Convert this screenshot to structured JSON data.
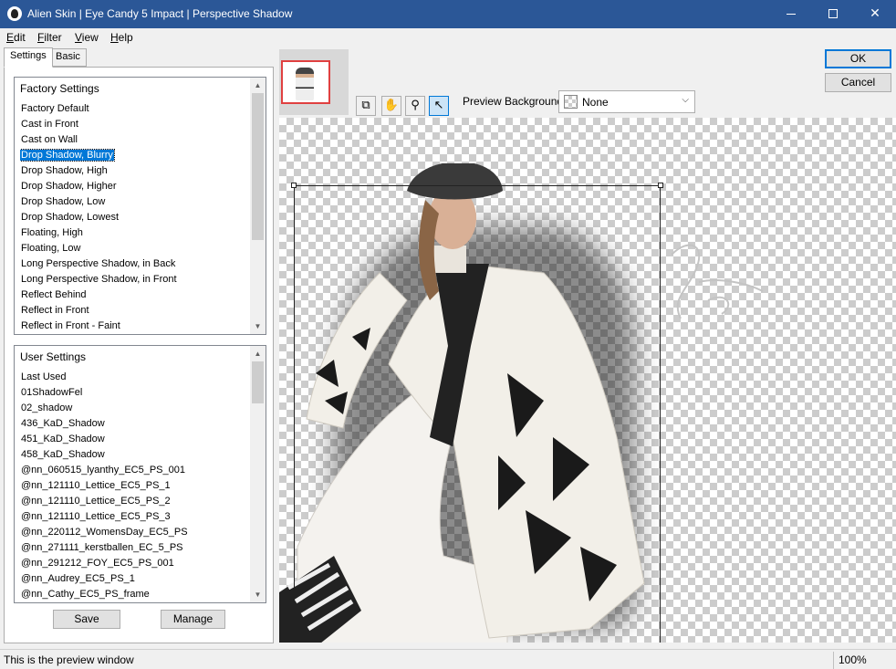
{
  "window": {
    "title": "Alien Skin | Eye Candy 5 Impact | Perspective Shadow",
    "minimize_icon": "minimize-icon",
    "maximize_icon": "maximize-icon",
    "close_icon": "close-icon"
  },
  "menu": {
    "items": [
      {
        "accel": "E",
        "rest": "dit"
      },
      {
        "accel": "F",
        "rest": "ilter"
      },
      {
        "accel": "V",
        "rest": "iew"
      },
      {
        "accel": "H",
        "rest": "elp"
      }
    ]
  },
  "tabs": [
    "Settings",
    "Basic"
  ],
  "factory": {
    "header": "Factory Settings",
    "items": [
      "Factory Default",
      "Cast in Front",
      "Cast on Wall",
      "Drop Shadow, Blurry",
      "Drop Shadow, High",
      "Drop Shadow, Higher",
      "Drop Shadow, Low",
      "Drop Shadow, Lowest",
      "Floating, High",
      "Floating, Low",
      "Long Perspective Shadow, in Back",
      "Long Perspective Shadow, in Front",
      "Reflect Behind",
      "Reflect in Front",
      "Reflect in Front - Faint"
    ],
    "selected_index": 3
  },
  "user": {
    "header": "User Settings",
    "items": [
      "Last Used",
      "01ShadowFel",
      "02_shadow",
      "436_KaD_Shadow",
      "451_KaD_Shadow",
      "458_KaD_Shadow",
      "@nn_060515_lyanthy_EC5_PS_001",
      "@nn_121110_Lettice_EC5_PS_1",
      "@nn_121110_Lettice_EC5_PS_2",
      "@nn_121110_Lettice_EC5_PS_3",
      "@nn_220112_WomensDay_EC5_PS",
      "@nn_271111_kerstballen_EC_5_PS",
      "@nn_291212_FOY_EC5_PS_001",
      "@nn_Audrey_EC5_PS_1",
      "@nn_Cathy_EC5_PS_frame"
    ]
  },
  "buttons": {
    "save": "Save",
    "manage": "Manage",
    "ok": "OK",
    "cancel": "Cancel"
  },
  "tools": [
    "navigator-icon",
    "hand-icon",
    "zoom-icon",
    "pointer-icon"
  ],
  "preview_background": {
    "label": "Preview Background:",
    "value": "None"
  },
  "status": {
    "text": "This is the preview window",
    "zoom": "100%"
  },
  "colors": {
    "accent": "#0078d7",
    "titlebar": "#2b5797",
    "selection": "#0078d7"
  }
}
